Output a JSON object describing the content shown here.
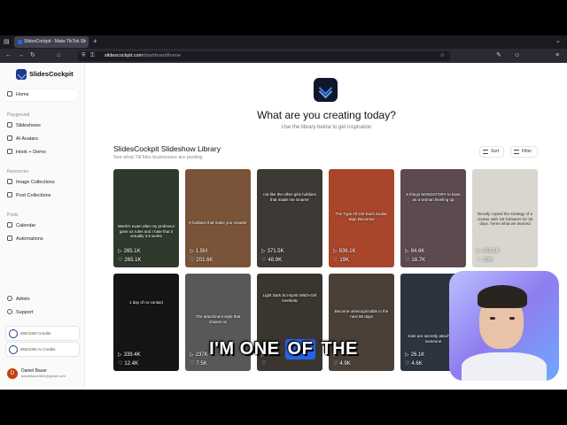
{
  "browser": {
    "tab_title": "SlidesCockpit - Make TikTok Sli",
    "tab_close": "×",
    "new_tab": "+",
    "url_host": "slidescockpit.com",
    "url_path": "/dashboard/home"
  },
  "sidebar": {
    "app_name": "SlidesCockpit",
    "home": "Home",
    "sections": {
      "playground": "Playground",
      "resources": "Resources",
      "posts": "Posts"
    },
    "playground_items": [
      "Slideshows",
      "AI Avatars",
      "Hook + Demo"
    ],
    "resources_items": [
      "Image Collections",
      "Post Collections"
    ],
    "posts_items": [
      "Calendar",
      "Automations"
    ],
    "bottom_items": [
      "Admin",
      "Support"
    ],
    "credits": [
      "895/1000 Credits",
      "993/1000 AI Credits"
    ],
    "user_name": "Daniel Bauer",
    "user_email": "danielbauer666@gmail.com",
    "user_initial": "D"
  },
  "main": {
    "hero_title": "What are you creating today?",
    "hero_sub": "Use the library below to get inspiration",
    "library_title": "SlidesCockpit Slideshow Library",
    "library_sub": "See what TikToks businesses are posting",
    "sort_label": "Sort",
    "filter_label": "Filter"
  },
  "cards": [
    {
      "caption": "Week'n exam after my professor gave us rules and I hate that it actually 3.5 works",
      "views": "265.1K",
      "likes": "265.1K",
      "bg": "#2f3a2c"
    },
    {
      "caption": "9 hobbies that make you smarter",
      "views": "1.5M",
      "likes": "201.6K",
      "bg": "#7a5438"
    },
    {
      "caption": "not like the other girls hobbies that made me smarter",
      "views": "371.5K",
      "likes": "48.9K",
      "bg": "#3d3a36"
    },
    {
      "caption": "The Type Of Girl Each Zodiac Sign Becomes",
      "views": "836.1K",
      "likes": "19K",
      "bg": "#a8452a"
    },
    {
      "caption": "5 things MANDATORY to have as a woman leveling up",
      "views": "84.6K",
      "likes": "18.7K",
      "bg": "#5c4a4e"
    },
    {
      "caption": "literally copied the strategy of a creator with 1M followers for 30 days. heres what we learned",
      "views": "303.1K",
      "likes": "30K",
      "bg": "#d9d6cf"
    },
    {
      "caption": "1 day of no contact",
      "views": "339.4K",
      "likes": "12.4K",
      "bg": "#141414"
    },
    {
      "caption": "The attachment style that chases us",
      "views": "237K",
      "likes": "7.5K",
      "bg": "#585858"
    },
    {
      "caption": "Light Dark Sci-Spirit Witch-Girl Aesthetic",
      "views": "",
      "likes": "",
      "bg": "#3b3530"
    },
    {
      "caption": "Become unrecognizable in the next 90 days",
      "views": "",
      "likes": "4.9K",
      "bg": "#4a4038"
    },
    {
      "caption": "Kate are secretly attached to someone",
      "views": "26.1K",
      "likes": "4.6K",
      "bg": "#2c3440"
    }
  ],
  "overlay": {
    "subtitle_before": "I'M ONE ",
    "subtitle_hl": "OF",
    "subtitle_after": " THE"
  },
  "icons": {
    "play": "▷",
    "heart": "♡"
  }
}
